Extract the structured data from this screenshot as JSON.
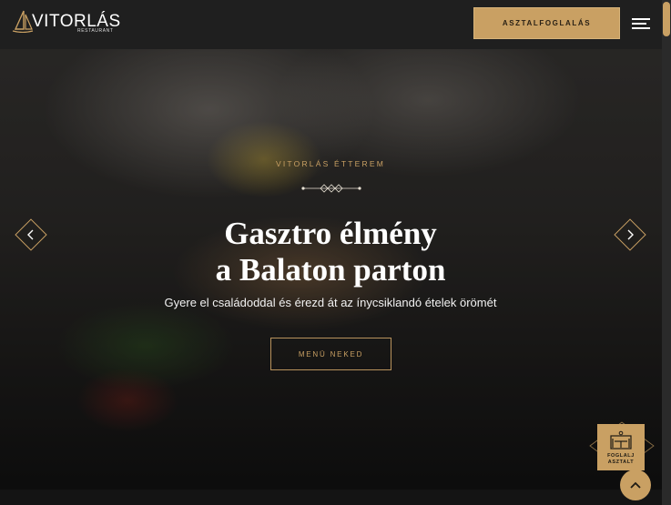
{
  "brand": {
    "name": "VITORLÁS",
    "subtitle": "RESTAURANT",
    "accent_color": "#c9a063"
  },
  "header": {
    "reserve_label": "ASZTALFOGLALÁS",
    "menu_icon": "hamburger-icon"
  },
  "hero": {
    "eyebrow": "VITORLÁS ÉTTEREM",
    "headline_line1": "Gasztro élmény",
    "headline_line2": "a Balaton parton",
    "subline": "Gyere el családoddal és érezd át az ínycsiklandó ételek örömét",
    "cta_label": "MENÜ NEKED",
    "prev_icon": "chevron-left-icon",
    "next_icon": "chevron-right-icon"
  },
  "floating": {
    "book_line1": "FOGLALJ",
    "book_line2": "ASZTALT",
    "book_icon": "table-chairs-icon",
    "top_icon": "chevron-up-icon"
  }
}
